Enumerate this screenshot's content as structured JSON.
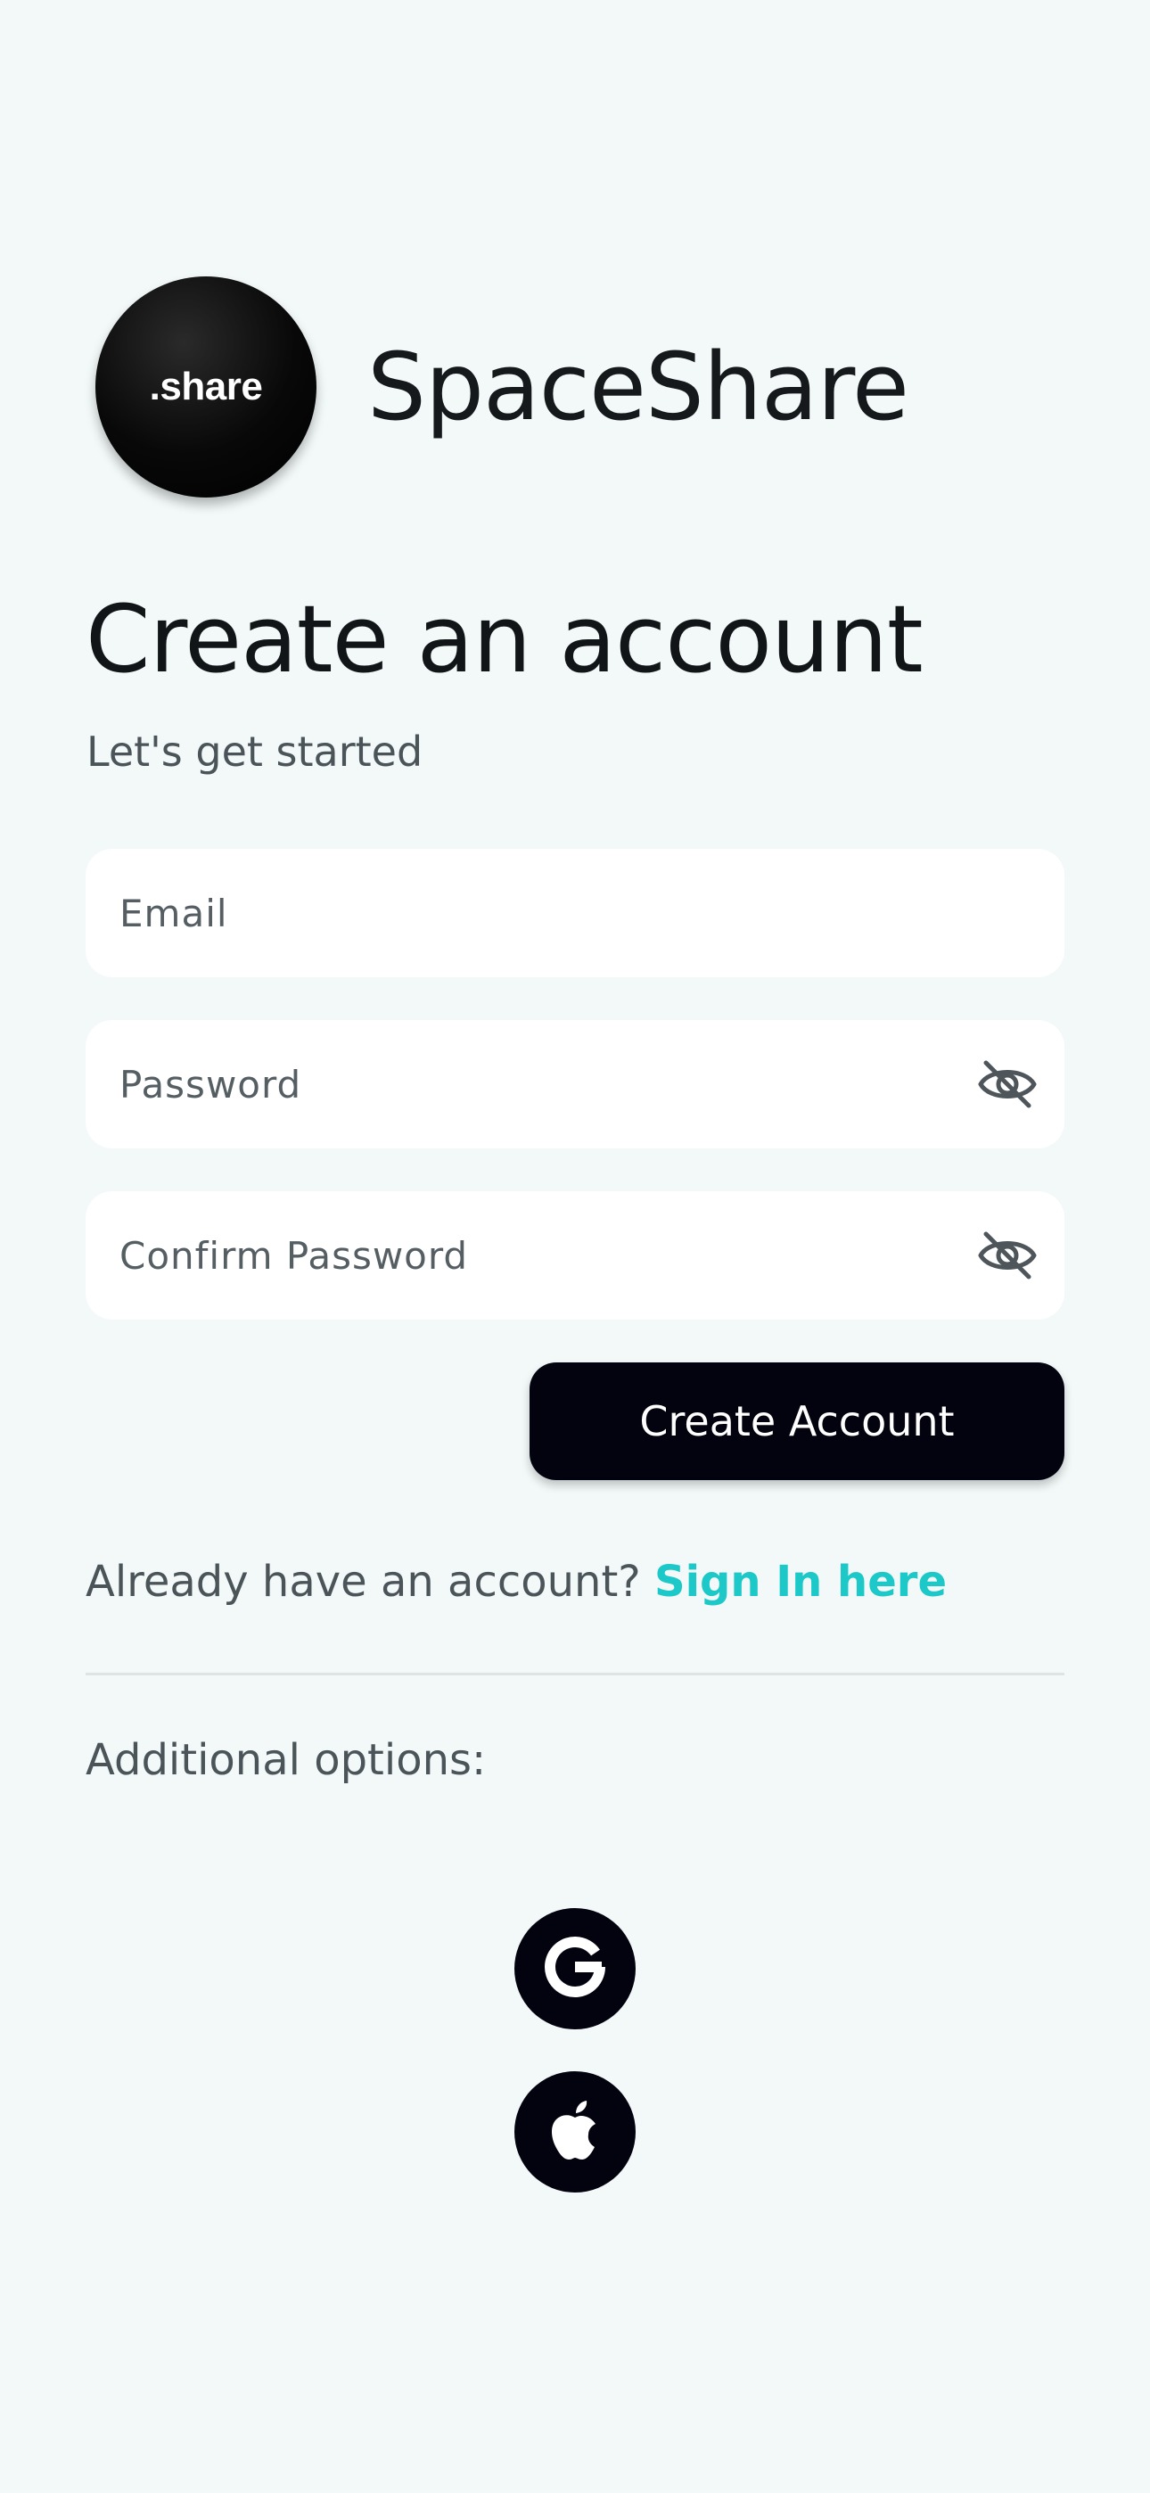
{
  "brand": {
    "logo_text": ".share",
    "app_name": "SpaceShare"
  },
  "header": {
    "title": "Create an account",
    "subtitle": "Let's get started"
  },
  "form": {
    "email_placeholder": "Email",
    "password_placeholder": "Password",
    "confirm_password_placeholder": "Confirm Password",
    "submit_label": "Create Account"
  },
  "signin": {
    "prompt": "Already have an account?",
    "link_label": "Sign In here"
  },
  "additional": {
    "label": "Additional options:",
    "providers": [
      "google-icon",
      "apple-icon"
    ]
  },
  "icons": {
    "password_toggle": "eye-off-icon",
    "confirm_password_toggle": "eye-off-icon"
  },
  "colors": {
    "background": "#f3f9f9",
    "accent": "#1cc8c8",
    "button": "#03030f"
  }
}
